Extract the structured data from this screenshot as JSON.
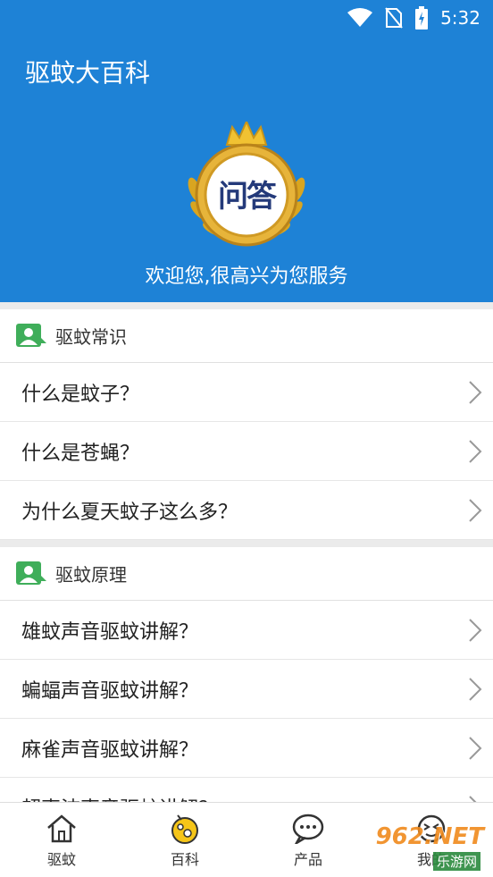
{
  "status_bar": {
    "time": "5:32"
  },
  "header": {
    "title": "驱蚊大百科",
    "badge_text": "问答",
    "welcome": "欢迎您,很高兴为您服务"
  },
  "sections": [
    {
      "title": "驱蚊常识",
      "items": [
        "什么是蚊子？",
        "什么是苍蝇？",
        "为什么夏天蚊子这么多？"
      ]
    },
    {
      "title": "驱蚊原理",
      "items": [
        "雄蚊声音驱蚊讲解？",
        "蝙蝠声音驱蚊讲解？",
        "麻雀声音驱蚊讲解？",
        "超声波声音驱蚊讲解？"
      ]
    }
  ],
  "bottom_nav": [
    {
      "label": "驱蚊",
      "icon": "home-icon"
    },
    {
      "label": "百科",
      "icon": "encyclopedia-icon"
    },
    {
      "label": "产品",
      "icon": "chat-icon"
    },
    {
      "label": "我的",
      "icon": "face-icon"
    }
  ],
  "watermark": {
    "brand": "962.NET",
    "sub": "乐游网"
  },
  "colors": {
    "header_bg": "#1e82d6",
    "section_icon": "#3fae5a",
    "nav_accent": "#f5c518"
  }
}
